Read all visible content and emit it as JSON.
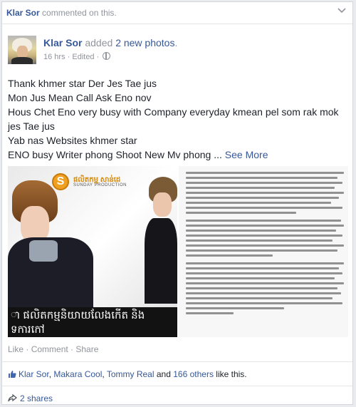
{
  "story": {
    "actor": "Klar Sor",
    "action": " commented on this."
  },
  "post": {
    "author": "Klar Sor",
    "verb": " added ",
    "photo_count": "2 new photos",
    "period": ".",
    "time": "16 hrs",
    "edited": "Edited",
    "separator": " · ",
    "text_lines": [
      "Thank khmer star Der Jes Tae jus",
      "Mon Jus Mean Call Ask Eno nov",
      "Hous Chet Eno very busy with Company everyday kmean pel som rak mok jes Tae jus",
      "Yab nas Websites khmer star",
      "ENO busy Writer phong Shoot New Mv phong ..."
    ],
    "see_more": "See More"
  },
  "photos": {
    "left": {
      "production_name": "ផលិតកម្ម សាន់ដេ",
      "production_sub": "SUNDAY PRODUCTION",
      "logo_letter": "S",
      "caption_line1": "ា ផលិតកម្មនិយាយលែងកើត និង",
      "caption_line2": "ទការកៅ"
    }
  },
  "actions": {
    "like": "Like",
    "comment": "Comment",
    "share": "Share",
    "sep": " · "
  },
  "likes": {
    "names": [
      "Klar Sor",
      "Makara Cool",
      "Tommy Real"
    ],
    "comma": ", ",
    "and": " and ",
    "others": "166 others",
    "suffix": " like this."
  },
  "shares": {
    "label": "2 shares"
  },
  "colors": {
    "link": "#365899",
    "muted": "#90949c",
    "text": "#1d2129"
  }
}
